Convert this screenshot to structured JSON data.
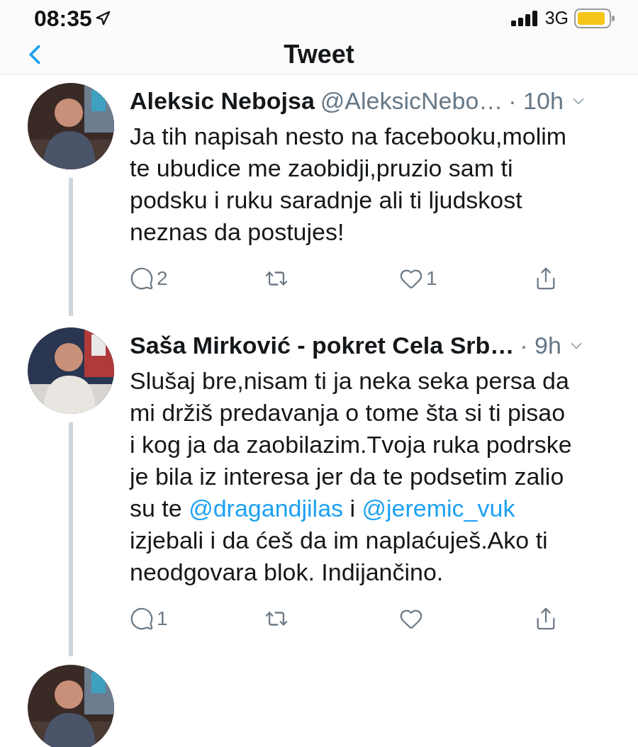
{
  "status_bar": {
    "time": "08:35",
    "network": "3G"
  },
  "nav": {
    "title": "Tweet"
  },
  "tweets": [
    {
      "name": "Aleksic Nebojsa",
      "handle": "@AleksicNebo…",
      "time": "· 10h",
      "avatar": {
        "kind": "picture"
      },
      "lines": [
        [
          {
            "kind": "text",
            "text": "Ja tih napisah nesto na facebooku,molim"
          }
        ],
        [
          {
            "kind": "text",
            "text": "te ubudice me zaobidji,pruzio sam ti"
          }
        ],
        [
          {
            "kind": "text",
            "text": "podsku i ruku saradnje ali ti ljudskost"
          }
        ],
        [
          {
            "kind": "text",
            "text": "neznas da postujes!"
          }
        ]
      ],
      "replies": "2",
      "likes": "1"
    },
    {
      "name": "Saša Mirković - pokret Cela Srb…",
      "time": "· 9h",
      "avatar": {
        "kind": "picture"
      },
      "lines": [
        [
          {
            "kind": "text",
            "text": "Slušaj bre,nisam ti ja neka seka persa da"
          }
        ],
        [
          {
            "kind": "text",
            "text": "mi držiš predavanja o tome šta si ti pisao"
          }
        ],
        [
          {
            "kind": "text",
            "text": "i kog ja da zaobilazim.Tvoja ruka podrske"
          }
        ],
        [
          {
            "kind": "text",
            "text": "je bila iz interesa jer da te podsetim zalio"
          }
        ],
        [
          {
            "kind": "text",
            "text": "su te "
          },
          {
            "kind": "mention",
            "text": "@dragandjilas"
          },
          {
            "kind": "text",
            "text": " i "
          },
          {
            "kind": "mention",
            "text": "@jeremic_vuk"
          }
        ],
        [
          {
            "kind": "text",
            "text": "izjebali i da ćeš da im naplaćuješ.Ako ti"
          }
        ],
        [
          {
            "kind": "text",
            "text": "neodgovara blok. Indijančino."
          }
        ]
      ],
      "replies": "1"
    }
  ]
}
